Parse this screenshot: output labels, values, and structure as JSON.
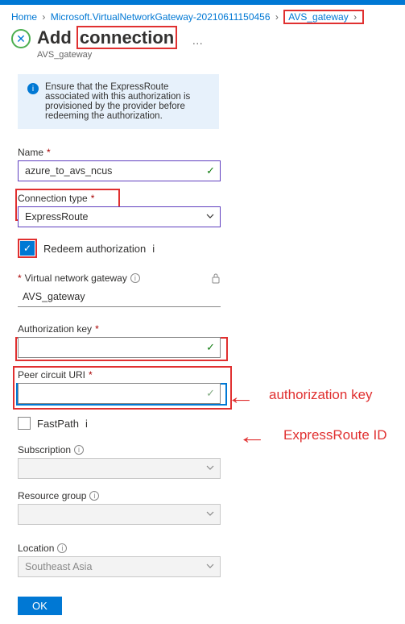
{
  "breadcrumb": {
    "home": "Home",
    "item1": "Microsoft.VirtualNetworkGateway-20210611150456",
    "last": "AVS_gateway"
  },
  "header": {
    "title_pre": "Add ",
    "title_boxed": "connection",
    "subtitle": "AVS_gateway",
    "more": "…"
  },
  "infobox": {
    "text": "Ensure that the ExpressRoute associated with this authorization is provisioned by the provider before redeeming the authorization."
  },
  "fields": {
    "name_label": "Name",
    "name_value": "azure_to_avs_ncus",
    "conn_type_label": "Connection type",
    "conn_type_value": "ExpressRoute",
    "redeem_label": "Redeem authorization",
    "vng_label": "Virtual network gateway",
    "vng_value": "AVS_gateway",
    "auth_key_label": "Authorization key",
    "auth_key_value": "",
    "peer_label": "Peer circuit URI",
    "peer_value": "",
    "fastpath_label": "FastPath",
    "subscription_label": "Subscription",
    "subscription_value": "",
    "rg_label": "Resource group",
    "rg_value": "",
    "location_label": "Location",
    "location_value": "Southeast Asia"
  },
  "buttons": {
    "ok": "OK"
  },
  "annotations": {
    "auth_key": "authorization key",
    "expressroute_id": "ExpressRoute ID"
  }
}
